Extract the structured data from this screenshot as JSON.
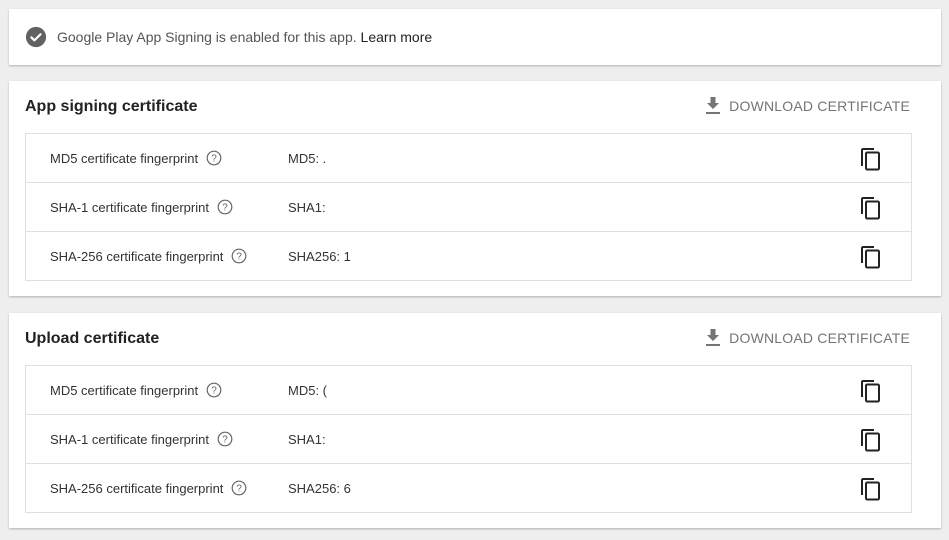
{
  "banner": {
    "message": "Google Play App Signing is enabled for this app.",
    "learn_more": "Learn more",
    "icon": "check-circle-icon"
  },
  "app_signing": {
    "title": "App signing certificate",
    "download_label": "DOWNLOAD CERTIFICATE",
    "rows": [
      {
        "label": "MD5 certificate fingerprint",
        "value": "MD5: ."
      },
      {
        "label": "SHA-1 certificate fingerprint",
        "value": "SHA1:"
      },
      {
        "label": "SHA-256 certificate fingerprint",
        "value": "SHA256: 1"
      }
    ]
  },
  "upload": {
    "title": "Upload certificate",
    "download_label": "DOWNLOAD CERTIFICATE",
    "rows": [
      {
        "label": "MD5 certificate fingerprint",
        "value": "MD5: ("
      },
      {
        "label": "SHA-1 certificate fingerprint",
        "value": "SHA1:"
      },
      {
        "label": "SHA-256 certificate fingerprint",
        "value": "SHA256: 6"
      }
    ]
  },
  "colors": {
    "background": "#eeeeee",
    "card": "#ffffff",
    "muted_text": "#757575",
    "icon": "#555555"
  }
}
